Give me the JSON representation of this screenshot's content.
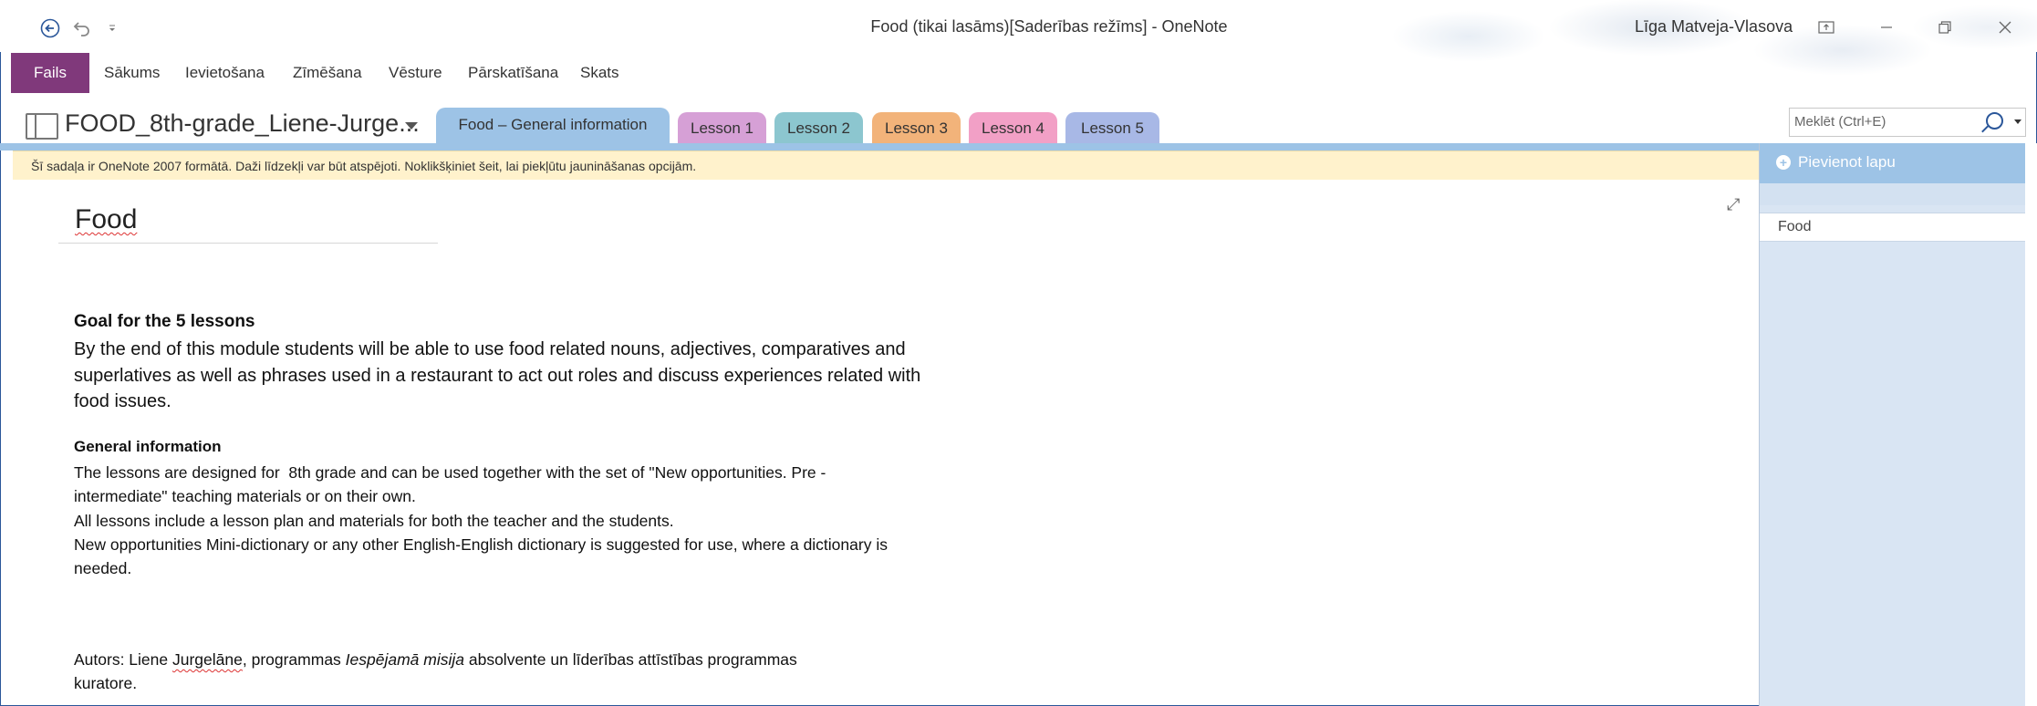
{
  "window": {
    "title": "Food (tikai lasāms)[Saderības režīms]  -  OneNote",
    "user": "Līga Matveja-Vlasova"
  },
  "ribbon": {
    "tabs": [
      "Fails",
      "Sākums",
      "Ievietošana",
      "Zīmēšana",
      "Vēsture",
      "Pārskatīšana",
      "Skats"
    ]
  },
  "notebook": {
    "name": "FOOD_8th-grade_Liene-Jurge..."
  },
  "sections": [
    {
      "label": "Food – General information",
      "color": "#9dc3e6"
    },
    {
      "label": "Lesson 1",
      "color": "#d6a0d6"
    },
    {
      "label": "Lesson 2",
      "color": "#8cc6cf"
    },
    {
      "label": "Lesson 3",
      "color": "#f2b37a"
    },
    {
      "label": "Lesson 4",
      "color": "#f2a0c6"
    },
    {
      "label": "Lesson 5",
      "color": "#a8b8e6"
    }
  ],
  "search": {
    "placeholder": "Meklēt (Ctrl+E)"
  },
  "infobar": {
    "text": "Šī sadaļa ir OneNote 2007 formātā. Daži līdzekļi var būt atspējoti. Noklikšķiniet šeit, lai piekļūtu jaunināšanas opcijām."
  },
  "pages_pane": {
    "add_label": "Pievienot lapu",
    "pages": [
      "Food"
    ]
  },
  "page": {
    "title": "Food",
    "goal_heading": "Goal for the 5 lessons",
    "goal_lines": [
      "By the end of this module students will be able to use food related nouns, adjectives, comparatives and",
      "superlatives as well as phrases used in a restaurant to act out roles and discuss experiences related with",
      "food issues."
    ],
    "general_heading": "General information",
    "general_lines": [
      "The lessons are designed for  8th grade and can be used together with the set of \"New opportunities. Pre -",
      "intermediate\" teaching materials or on their own.",
      "All lessons include a lesson plan and materials for both the teacher and the students.",
      "New opportunities Mini-dictionary or any other English-English dictionary is suggested for use, where a dictionary is",
      "needed."
    ],
    "author": {
      "prefix": "Autors: Liene ",
      "surname": "Jurgelāne",
      "middle": ", programmas ",
      "program": "Iespējamā misija",
      "suffix": " absolvente un līderības attīstības programmas",
      "line2": "kuratore."
    }
  }
}
